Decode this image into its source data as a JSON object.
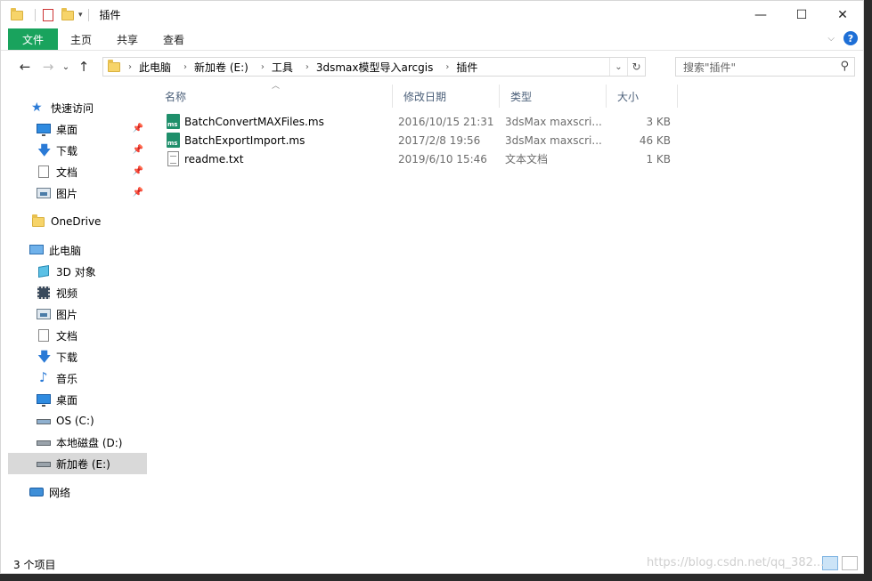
{
  "window": {
    "title": "插件",
    "controls": {
      "minimize": "—",
      "maximize": "☐",
      "close": "✕"
    }
  },
  "ribbon": {
    "tabs": [
      {
        "label": "文件"
      },
      {
        "label": "主页"
      },
      {
        "label": "共享"
      },
      {
        "label": "查看"
      }
    ],
    "help": "?"
  },
  "address": {
    "crumbs": [
      "此电脑",
      "新加卷 (E:)",
      "工具",
      "3dsmax模型导入arcgis",
      "插件"
    ]
  },
  "search": {
    "placeholder": "搜索\"插件\""
  },
  "sidebar": {
    "items": [
      {
        "label": "快速访问",
        "icon": "star-icon"
      },
      {
        "label": "桌面",
        "icon": "desktop-icon",
        "pinned": true
      },
      {
        "label": "下载",
        "icon": "download-icon",
        "pinned": true
      },
      {
        "label": "文档",
        "icon": "document-icon",
        "pinned": true
      },
      {
        "label": "图片",
        "icon": "picture-icon",
        "pinned": true
      },
      {
        "label": "OneDrive",
        "icon": "folder-icon"
      },
      {
        "label": "此电脑",
        "icon": "computer-icon"
      },
      {
        "label": "3D 对象",
        "icon": "cube-icon"
      },
      {
        "label": "视频",
        "icon": "video-icon"
      },
      {
        "label": "图片",
        "icon": "picture-icon"
      },
      {
        "label": "文档",
        "icon": "document-icon"
      },
      {
        "label": "下载",
        "icon": "download-icon"
      },
      {
        "label": "音乐",
        "icon": "music-icon"
      },
      {
        "label": "桌面",
        "icon": "desktop-icon"
      },
      {
        "label": "OS (C:)",
        "icon": "drive-icon"
      },
      {
        "label": "本地磁盘 (D:)",
        "icon": "drive-icon"
      },
      {
        "label": "新加卷 (E:)",
        "icon": "drive-icon",
        "selected": true
      },
      {
        "label": "网络",
        "icon": "network-icon"
      }
    ]
  },
  "columns": {
    "name": "名称",
    "date": "修改日期",
    "type": "类型",
    "size": "大小"
  },
  "files": [
    {
      "name": "BatchConvertMAXFiles.ms",
      "date": "2016/10/15 21:31",
      "type": "3dsMax maxscri...",
      "size": "3 KB",
      "icon": "maxscript-file-icon"
    },
    {
      "name": "BatchExportImport.ms",
      "date": "2017/2/8 19:56",
      "type": "3dsMax maxscri...",
      "size": "46 KB",
      "icon": "maxscript-file-icon"
    },
    {
      "name": "readme.txt",
      "date": "2019/6/10 15:46",
      "type": "文本文档",
      "size": "1 KB",
      "icon": "text-file-icon"
    }
  ],
  "status": {
    "count": "3 个项目"
  },
  "watermark": "https://blog.csdn.net/qq_382..."
}
